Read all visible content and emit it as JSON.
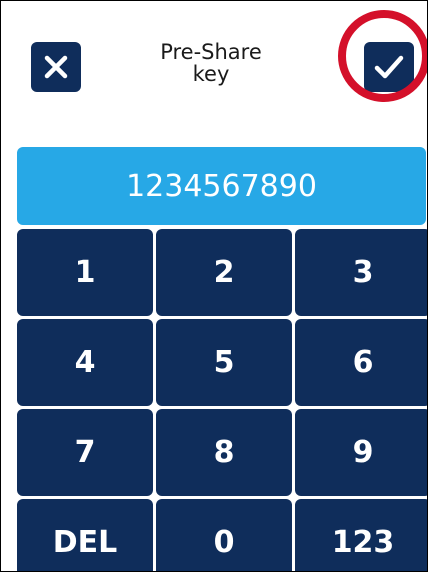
{
  "header": {
    "title_line1": "Pre-Share",
    "title_line2": "key",
    "cancel_icon": "close-icon",
    "confirm_icon": "check-icon"
  },
  "display": {
    "value": "1234567890"
  },
  "keypad": {
    "keys": [
      "1",
      "2",
      "3",
      "4",
      "5",
      "6",
      "7",
      "8",
      "9",
      "DEL",
      "0",
      "123"
    ]
  },
  "colors": {
    "button_navy": "#0f2d5b",
    "display_blue": "#27a8e6",
    "highlight_red": "#d4102a"
  }
}
